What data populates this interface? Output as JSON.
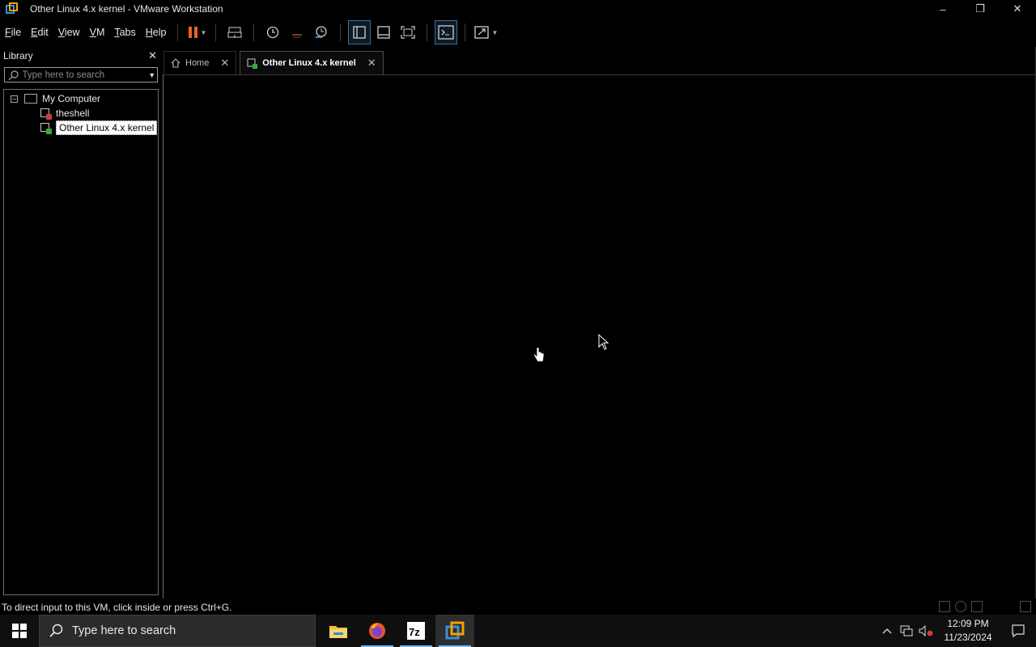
{
  "window": {
    "title": "Other Linux 4.x kernel - VMware Workstation",
    "controls": {
      "minimize": "–",
      "restore": "❐",
      "close": "✕"
    }
  },
  "menu": {
    "items": [
      {
        "label": "File",
        "underline": "F",
        "rest": "ile"
      },
      {
        "label": "Edit",
        "underline": "E",
        "rest": "dit"
      },
      {
        "label": "View",
        "underline": "V",
        "rest": "iew"
      },
      {
        "label": "VM",
        "underline": "V",
        "rest": "M"
      },
      {
        "label": "Tabs",
        "underline": "T",
        "rest": "abs"
      },
      {
        "label": "Help",
        "underline": "H",
        "rest": "elp"
      }
    ]
  },
  "library": {
    "title": "Library",
    "close": "✕",
    "search_placeholder": "Type here to search",
    "tree": {
      "root": "My Computer",
      "expander": "–",
      "vms": [
        "theshell",
        "Other Linux 4.x kernel"
      ]
    }
  },
  "tabs": [
    {
      "label": "Home",
      "close": "✕"
    },
    {
      "label": "Other Linux 4.x kernel",
      "close": "✕"
    }
  ],
  "status": {
    "message": "To direct input to this VM, click inside or press Ctrl+G."
  },
  "taskbar": {
    "search_placeholder": "Type here to search",
    "apps": [
      "file-explorer",
      "firefox",
      "7-zip",
      "vmware-workstation"
    ],
    "clock": {
      "time": "12:09 PM",
      "date": "11/23/2024"
    }
  },
  "colors": {
    "accent_orange": "#e9632a",
    "vmware_blue": "#3d8fd6",
    "vmware_orange": "#f4a300",
    "taskbar_indicator": "#76b9ed"
  }
}
